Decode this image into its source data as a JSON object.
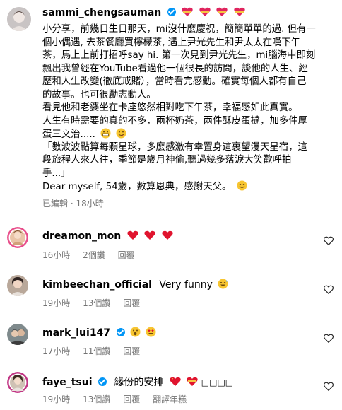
{
  "caption": {
    "username": "sammi_chengsauman",
    "lines": [
      "小分享，前幾日生日那天，mi沒什麼慶祝，簡簡單單的過. 但有一",
      "個小偶遇, 去茶餐廳買檸檬茶, 遇上尹光先生和尹太太在嘆下午",
      "茶，馬上上前打招呼say hi. 第一次見到尹光先生，mi腦海中即刻",
      "飄出我曾經在YouTube看過他一個很長的訪問，談他的人生、經",
      "歷和人生改變(徹底戒賭），當時看完感動。確實每個人都有自己",
      "的故事。也可很勵志動人。",
      "看見他和老婆坐在卡座悠然相對吃下午茶，幸福感如此真實。",
      "人生有時需要的真的不多，兩杯奶茶，兩件酥皮蛋撻，加多件厚",
      "蛋三文治.....",
      "「數波波點算每顆星球，多麼感激有幸置身這裏望漫天星宿，這",
      "段旅程人來人往，季節是歲月神偷,聽過幾多落淚大笑歡呼拍",
      "手...」",
      "Dear myself, 54歲，數算恩典，感謝天父。"
    ],
    "edited": "已編輯",
    "time": "18小時"
  },
  "comments": [
    {
      "username": "dreamon_mon",
      "text": "",
      "time": "16小時",
      "likes": "2個讚",
      "reply": "回覆",
      "translate": ""
    },
    {
      "username": "kimbeechan_official",
      "text": "Very funny",
      "time": "19小時",
      "likes": "13個讚",
      "reply": "回覆",
      "translate": ""
    },
    {
      "username": "mark_lui147",
      "text": "",
      "time": "17小時",
      "likes": "11個讚",
      "reply": "回覆",
      "translate": ""
    },
    {
      "username": "faye_tsui",
      "text": "緣份的安排",
      "trail": "□□□□",
      "time": "19小時",
      "likes": "13個讚",
      "reply": "回覆",
      "translate": "翻譯年糕"
    }
  ]
}
